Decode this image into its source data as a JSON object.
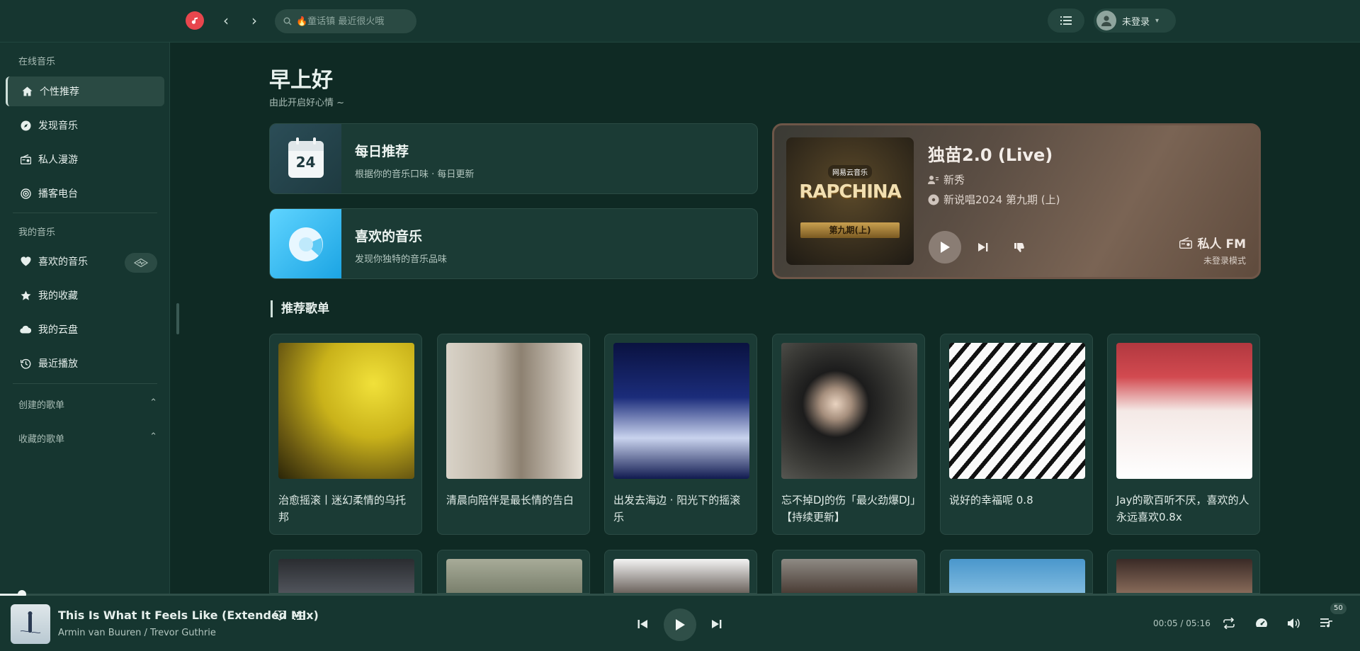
{
  "search": {
    "placeholder": "🔥童话镇 最近很火哦"
  },
  "user": {
    "label": "未登录"
  },
  "sidebar": {
    "online_title": "在线音乐",
    "mine_title": "我的音乐",
    "items": [
      {
        "label": "个性推荐",
        "icon": "home-icon"
      },
      {
        "label": "发现音乐",
        "icon": "compass-icon"
      },
      {
        "label": "私人漫游",
        "icon": "radio-icon"
      },
      {
        "label": "播客电台",
        "icon": "podcast-icon"
      },
      {
        "label": "喜欢的音乐",
        "icon": "heart-icon"
      },
      {
        "label": "我的收藏",
        "icon": "star-icon"
      },
      {
        "label": "我的云盘",
        "icon": "cloud-icon"
      },
      {
        "label": "最近播放",
        "icon": "history-icon"
      }
    ],
    "created_lists": "创建的歌单",
    "collected_lists": "收藏的歌单"
  },
  "main": {
    "greeting": "早上好",
    "greeting_sub": "由此开启好心情 ~",
    "daily": {
      "title": "每日推荐",
      "desc": "根据你的音乐口味 · 每日更新",
      "date": "24"
    },
    "liked": {
      "title": "喜欢的音乐",
      "desc": "发现你独特的音乐品味"
    },
    "fm": {
      "song": "独苗2.0 (Live)",
      "artist": "新秀",
      "album": "新说唱2024 第九期 (上)",
      "label": "私人 FM",
      "mode": "未登录模式",
      "cover_brand": "网易云音乐",
      "cover_title": "RAPCHINA",
      "cover_episode": "第九期(上)"
    },
    "section_title": "推荐歌单",
    "playlists": [
      {
        "name": "治愈摇滚丨迷幻柔情的乌托邦"
      },
      {
        "name": "清晨向陪伴是最长情的告白"
      },
      {
        "name": "出发去海边 · 阳光下的摇滚乐"
      },
      {
        "name": "忘不掉DJ的伤「最火劲爆DJ」【持续更新】"
      },
      {
        "name": "说好的幸福呢 0.8"
      },
      {
        "name": "Jay的歌百听不厌，喜欢的人永远喜欢0.8x"
      }
    ]
  },
  "player": {
    "song": "This Is What It Feels Like (Extended Mix)",
    "artist": "Armin van Buuren / Trevor Guthrie",
    "time": "00:05 / 05:16",
    "volume_badge": "50",
    "progress": 0.016
  }
}
